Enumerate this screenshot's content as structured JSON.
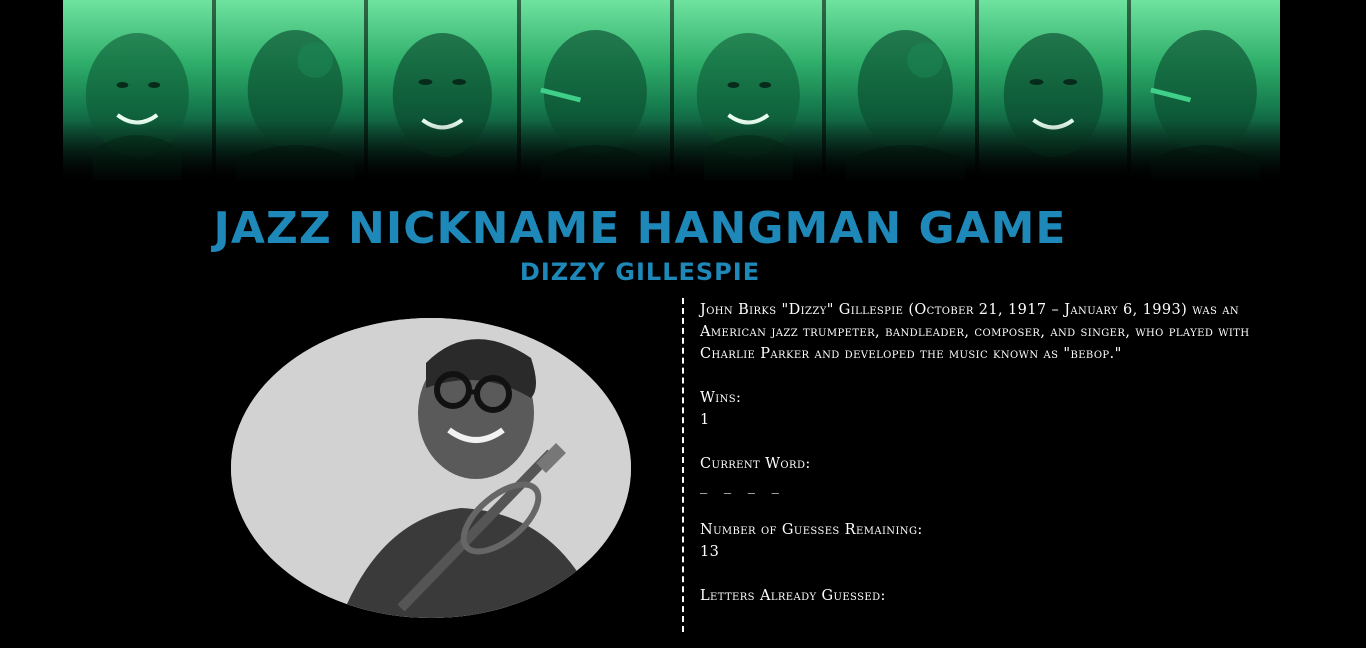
{
  "header": {
    "title": "JAZZ NICKNAME HANGMAN GAME",
    "subtitle": "DIZZY GILLESPIE"
  },
  "bio": "John Birks \"Dizzy\" Gillespie (October 21, 1917 – January 6, 1993) was an American jazz trumpeter, bandleader, composer, and singer, who played with Charlie Parker and developed the music known as \"bebop.\"",
  "stats": {
    "wins_label": "Wins:",
    "wins_value": "1",
    "current_word_label": "Current Word:",
    "current_word_value": "_ _ _ _",
    "guesses_label": "Number of Guesses Remaining:",
    "guesses_value": "13",
    "letters_label": "Letters Already Guessed:",
    "letters_value": ""
  },
  "colors": {
    "title": "#1e88b8",
    "banner_top": "#6fe3a0",
    "banner_mid": "#157a4d",
    "background": "#000000"
  }
}
